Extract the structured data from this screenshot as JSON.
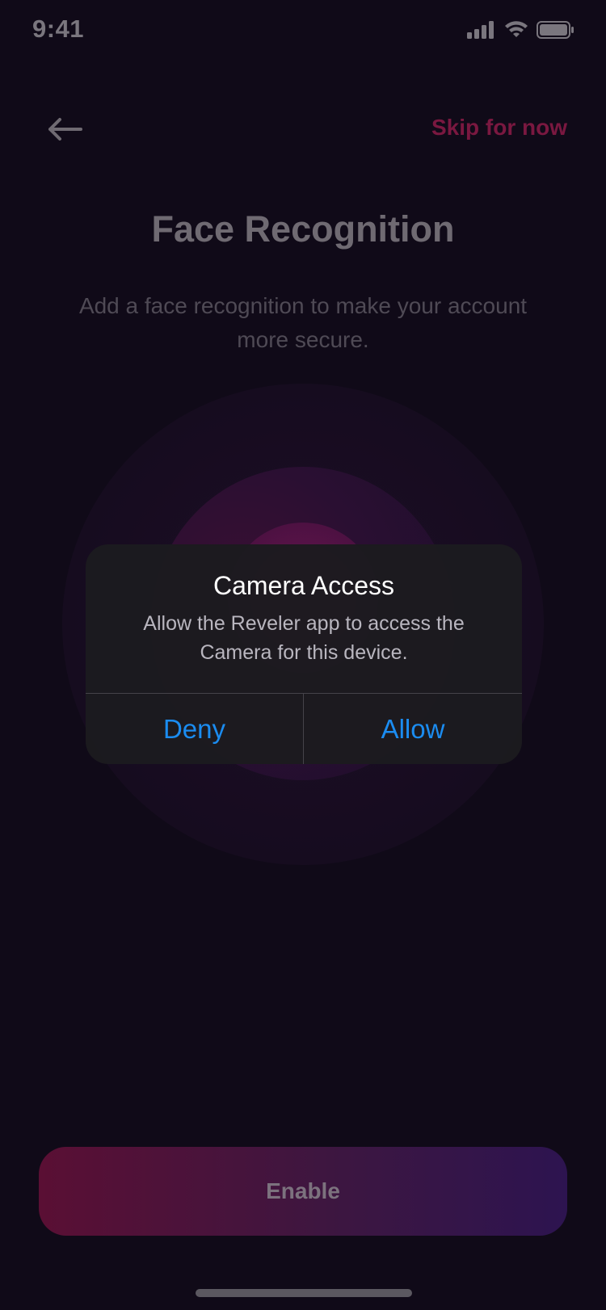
{
  "status_bar": {
    "time": "9:41",
    "icons": [
      "cellular-signal-icon",
      "wifi-icon",
      "battery-icon"
    ]
  },
  "header": {
    "back_icon": "arrow-left-icon",
    "skip_label": "Skip for now"
  },
  "page": {
    "title": "Face Recognition",
    "subtitle": "Add a face recognition to make your account more secure."
  },
  "primary_button": {
    "label": "Enable"
  },
  "dialog": {
    "title": "Camera Access",
    "message": "Allow the Reveler app to access the Camera for this device.",
    "deny_label": "Deny",
    "allow_label": "Allow"
  },
  "colors": {
    "background": "#100a18",
    "accent_link": "#7a1840",
    "dialog_button": "#1b8cf0",
    "button_gradient_start": "#5a0f34",
    "button_gradient_end": "#2d1450"
  }
}
